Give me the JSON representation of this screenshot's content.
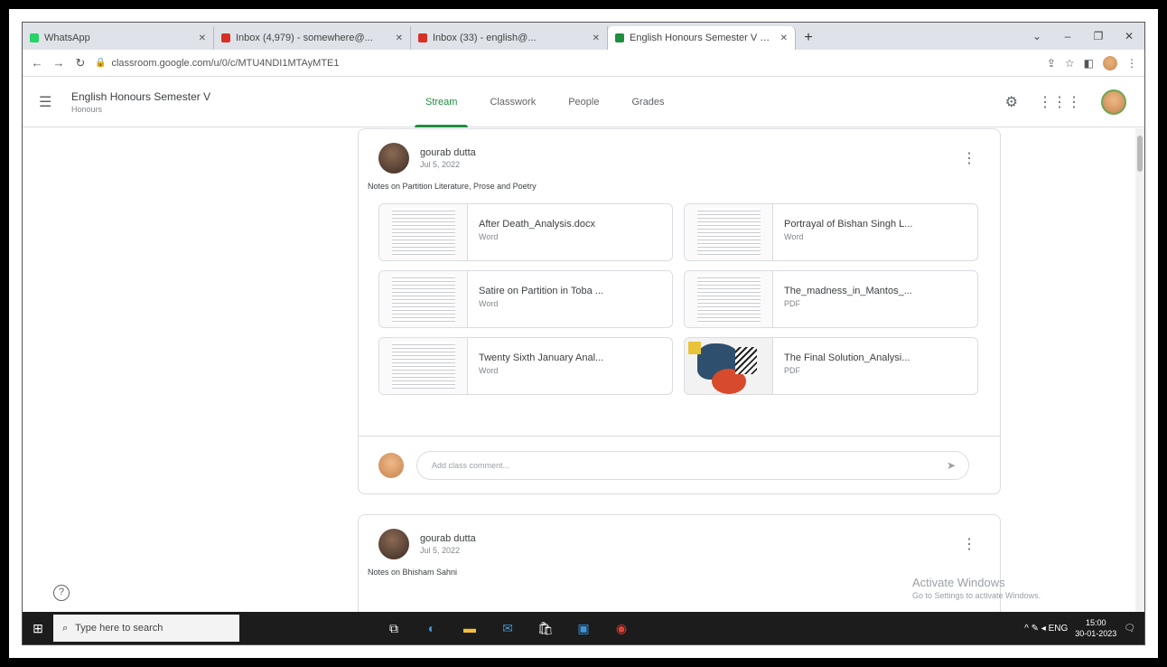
{
  "browser": {
    "tabs": [
      {
        "title": "WhatsApp",
        "color": "#25d366",
        "active": false
      },
      {
        "title": "Inbox (4,979) - somewhere@...",
        "color": "#d93025",
        "active": false
      },
      {
        "title": "Inbox (33) - english@...",
        "color": "#d93025",
        "active": false
      },
      {
        "title": "English Honours Semester V Pol...",
        "color": "#1e8e3e",
        "active": true
      }
    ],
    "new_tab": "+",
    "url": "classroom.google.com/u/0/c/MTU4NDI1MTAyMTE1",
    "window_controls": [
      "⌄",
      "–",
      "❐",
      "✕"
    ]
  },
  "classroom": {
    "class_title": "English Honours Semester V",
    "class_subtitle": "Honours",
    "nav_tabs": [
      "Stream",
      "Classwork",
      "People",
      "Grades"
    ],
    "active_tab": "Stream"
  },
  "posts": [
    {
      "author": "gourab dutta",
      "date": "Jul 5, 2022",
      "text": "Notes on Partition Literature, Prose and Poetry",
      "attachments": [
        {
          "title": "After Death_Analysis.docx",
          "type": "Word",
          "thumb": "doc"
        },
        {
          "title": "Portrayal of Bishan Singh L...",
          "type": "Word",
          "thumb": "doc"
        },
        {
          "title": "Satire on Partition in Toba ...",
          "type": "Word",
          "thumb": "doc"
        },
        {
          "title": "The_madness_in_Mantos_...",
          "type": "PDF",
          "thumb": "doc"
        },
        {
          "title": "Twenty Sixth January Anal...",
          "type": "Word",
          "thumb": "doc"
        },
        {
          "title": "The Final Solution_Analysi...",
          "type": "PDF",
          "thumb": "image"
        }
      ],
      "comment_placeholder": "Add class comment..."
    },
    {
      "author": "gourab dutta",
      "date": "Jul 5, 2022",
      "text": "Notes on Bhisham Sahni"
    }
  ],
  "watermark": {
    "line1": "Activate Windows",
    "line2": "Go to Settings to activate Windows."
  },
  "taskbar": {
    "search_placeholder": "Type here to search",
    "time": "15:00",
    "date": "30-01-2023",
    "tray_text": "^ ✎ ◂ ENG"
  }
}
